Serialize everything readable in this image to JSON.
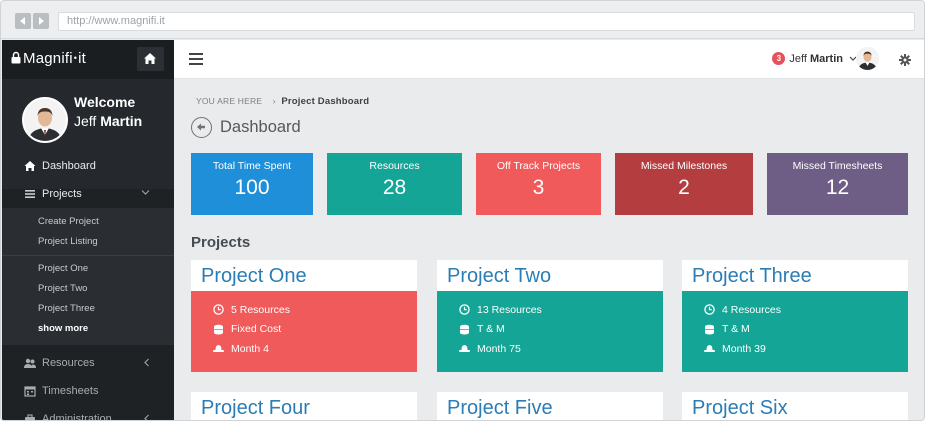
{
  "browser": {
    "url": "http://www.magnifi.it"
  },
  "colors": {
    "sidebar": "#1f2225",
    "blue": "#1e8fd8",
    "teal": "#14a596",
    "coral": "#f15a5a",
    "red": "#b43d40",
    "purple": "#6e5e85",
    "card_title": "#2b7db5"
  },
  "sidebar": {
    "brand": "Magnifi",
    "brand_suffix": "it",
    "welcome": "Welcome",
    "user_first": "Jeff",
    "user_last": "Martin",
    "menu": [
      {
        "label": "Dashboard",
        "icon": "home-icon"
      },
      {
        "label": "Projects",
        "icon": "list-icon"
      }
    ],
    "projects_sub": [
      "Create Project",
      "Project Listing"
    ],
    "project_list": [
      "Project One",
      "Project Two",
      "Project Three"
    ],
    "show_more": "show more",
    "menu_bottom": [
      {
        "label": "Resources",
        "icon": "users-icon"
      },
      {
        "label": "Timesheets",
        "icon": "calendar-icon"
      },
      {
        "label": "Administration",
        "icon": "briefcase-icon"
      }
    ]
  },
  "header": {
    "notification_count": "3",
    "user_first": "Jeff",
    "user_last": "Martin"
  },
  "breadcrumb": {
    "prefix": "YOU ARE HERE",
    "current": "Project Dashboard"
  },
  "page_title": "Dashboard",
  "stats": [
    {
      "label": "Total Time Spent",
      "value": "100"
    },
    {
      "label": "Resources",
      "value": "28"
    },
    {
      "label": "Off Track Projects",
      "value": "3"
    },
    {
      "label": "Missed Milestones",
      "value": "2"
    },
    {
      "label": "Missed Timesheets",
      "value": "12"
    }
  ],
  "section_title": "Projects",
  "projects": [
    {
      "name": "Project One",
      "resources": "5 Resources",
      "cost": "Fixed Cost",
      "duration": "Month 4"
    },
    {
      "name": "Project Two",
      "resources": "13 Resources",
      "cost": "T & M",
      "duration": "Month 75"
    },
    {
      "name": "Project Three",
      "resources": "4 Resources",
      "cost": "T & M",
      "duration": "Month 39"
    },
    {
      "name": "Project Four"
    },
    {
      "name": "Project Five"
    },
    {
      "name": "Project Six"
    }
  ]
}
